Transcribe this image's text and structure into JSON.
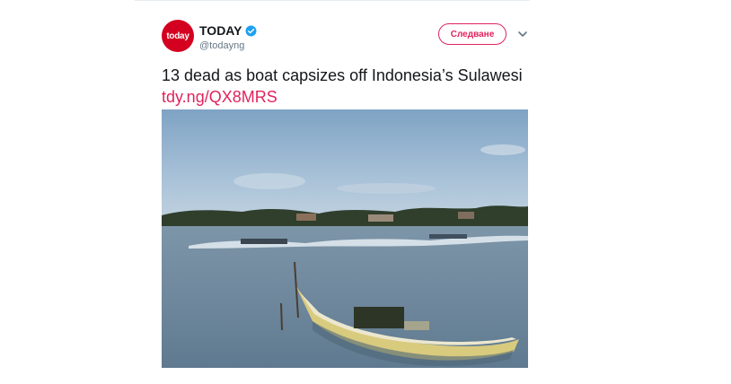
{
  "account": {
    "display_name": "TODAY",
    "handle": "@todayng",
    "avatar_text": "today",
    "avatar_color": "#d3001f",
    "verified": true
  },
  "follow_button": {
    "label": "Следване"
  },
  "tweet": {
    "text": "13 dead as boat capsizes off Indonesia’s Sulawesi",
    "link_text": "tdy.ng/QX8MRS"
  },
  "colors": {
    "accent": "#e0245e",
    "verified": "#1da1f2"
  },
  "icons": {
    "verified": "verified-badge-icon",
    "menu": "chevron-down-icon"
  }
}
